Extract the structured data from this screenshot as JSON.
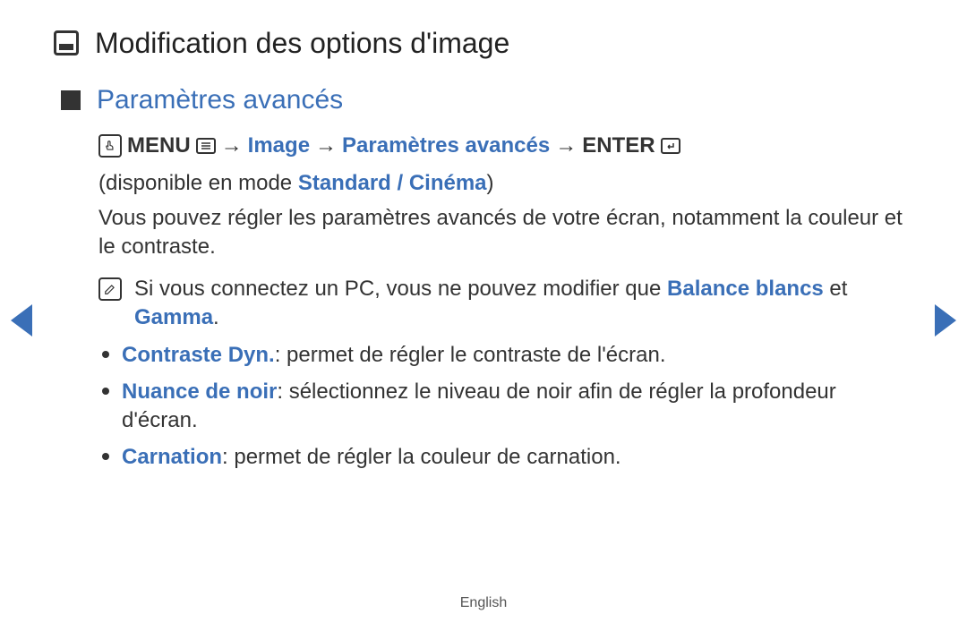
{
  "title": "Modification des options d'image",
  "section_title": "Paramètres avancés",
  "breadcrumb": {
    "menu": "MENU",
    "arrow": "→",
    "image": "Image",
    "params": "Paramètres avancés",
    "enter": "ENTER"
  },
  "availability": {
    "prefix": "(disponible en mode ",
    "modes": "Standard / Cinéma",
    "suffix": ")"
  },
  "description": "Vous pouvez régler les paramètres avancés de votre écran, notamment la couleur et le contraste.",
  "note": {
    "part1": "Si vous connectez un PC, vous ne pouvez modifier que ",
    "hl1": "Balance blancs",
    "mid": " et ",
    "hl2": "Gamma",
    "end": "."
  },
  "items": [
    {
      "label": "Contraste Dyn.",
      "text": ": permet de régler le contraste de l'écran."
    },
    {
      "label": "Nuance de noir",
      "text": ": sélectionnez le niveau de noir afin de régler la profondeur d'écran."
    },
    {
      "label": "Carnation",
      "text": ": permet de régler la couleur de carnation."
    }
  ],
  "footer": "English"
}
